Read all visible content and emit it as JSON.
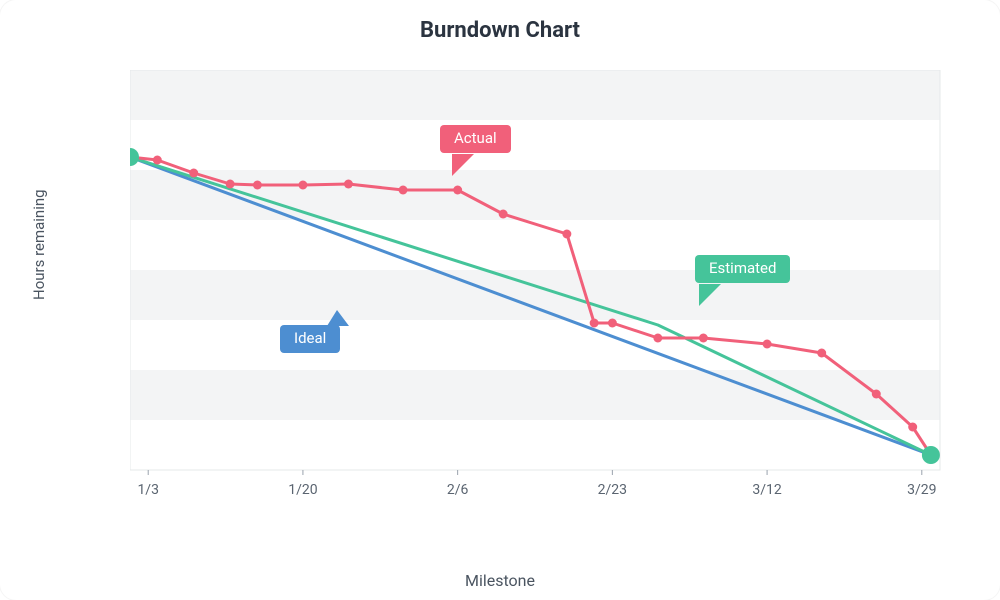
{
  "title": "Burndown Chart",
  "ylabel": "Hours remaining",
  "xlabel": "Milestone",
  "annotations": {
    "actual": "Actual",
    "estimated": "Estimated",
    "ideal": "Ideal"
  },
  "chart_data": {
    "type": "line",
    "xlabel": "Milestone",
    "ylabel": "Hours remaining",
    "ylim": [
      0,
      40
    ],
    "yticks": [
      0,
      5,
      10,
      15,
      20,
      25,
      30,
      35,
      40
    ],
    "xrange": [
      "1/1",
      "3/31"
    ],
    "xticks": [
      "1/3",
      "1/20",
      "2/6",
      "2/23",
      "3/12",
      "3/29"
    ],
    "endpoints": {
      "start": {
        "x": "1/1",
        "y": 31.3
      },
      "end": {
        "x": "3/30",
        "y": 1.5
      }
    },
    "series": [
      {
        "name": "Ideal",
        "color": "#4d8ed1",
        "x": [
          "1/1",
          "3/30"
        ],
        "y": [
          31.3,
          1.5
        ]
      },
      {
        "name": "Estimated",
        "color": "#45c49a",
        "x": [
          "1/1",
          "2/28",
          "3/30"
        ],
        "y": [
          31.3,
          14.5,
          1.5
        ]
      },
      {
        "name": "Actual",
        "color": "#f1607a",
        "marker": true,
        "x": [
          "1/1",
          "1/4",
          "1/8",
          "1/12",
          "1/15",
          "1/20",
          "1/25",
          "1/31",
          "2/6",
          "2/11",
          "2/18",
          "2/21",
          "2/23",
          "2/28",
          "3/5",
          "3/12",
          "3/18",
          "3/24",
          "3/28",
          "3/30"
        ],
        "y": [
          31.3,
          31.0,
          29.7,
          28.6,
          28.5,
          28.5,
          28.6,
          28.0,
          28.0,
          25.6,
          23.6,
          14.7,
          14.7,
          13.2,
          13.2,
          12.6,
          11.7,
          7.6,
          4.3,
          1.5
        ]
      }
    ]
  }
}
